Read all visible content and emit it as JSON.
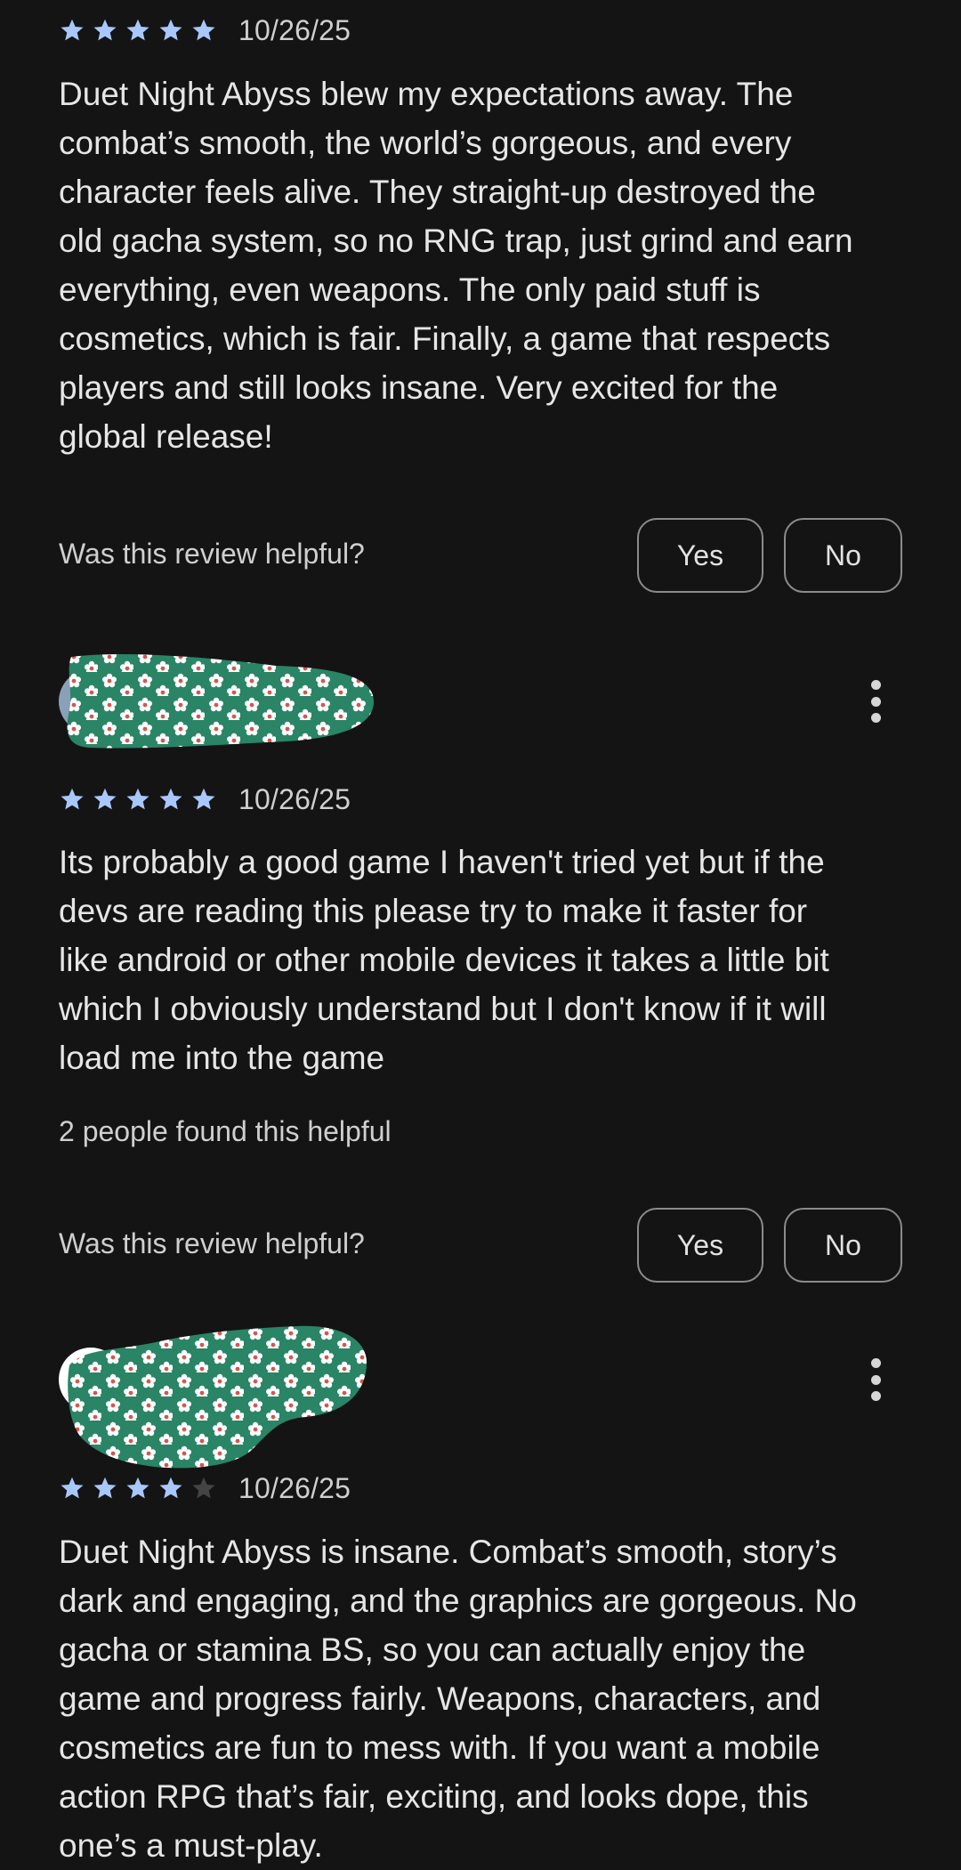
{
  "reviews": [
    {
      "rating": 5,
      "date": "10/26/25",
      "text": "Duet Night Abyss blew my expectations away. The\ncombat’s smooth, the world’s gorgeous, and every\ncharacter feels alive. They straight-up destroyed the\nold gacha system, so no RNG trap, just grind and earn\neverything, even weapons. The only paid stuff is\ncosmetics, which is fair. Finally, a game that respects\nplayers and still looks insane. Very excited for the\nglobal release!",
      "helpful_prompt": "Was this review helpful?",
      "yes_label": "Yes",
      "no_label": "No"
    },
    {
      "rating": 5,
      "date": "10/26/25",
      "text": "Its probably a good game I haven't tried yet but if the\ndevs are reading this please try to make it faster for\nlike android or other mobile devices it takes a little bit\nwhich I obviously understand but I don't know if it will\nload me into the game",
      "helpful_count": "2 people found this helpful",
      "helpful_prompt": "Was this review helpful?",
      "yes_label": "Yes",
      "no_label": "No"
    },
    {
      "rating": 4,
      "date": "10/26/25",
      "text": "Duet Night Abyss is insane. Combat’s smooth, story’s\ndark and engaging, and the graphics are gorgeous. No\ngacha or stamina BS, so you can actually enjoy the\ngame and progress fairly. Weapons, characters, and\ncosmetics are fun to mess with. If you want a mobile\naction RPG that’s fair, exciting, and looks dope, this\none’s a must-play."
    }
  ],
  "icons": {
    "star_filled": "star-icon",
    "star_empty": "star-outline-icon",
    "more": "more-vert-icon"
  },
  "colors": {
    "background": "#141414",
    "star_filled": "#a8c7fa",
    "star_empty": "#444444",
    "redaction_fill": "#2a8466",
    "redaction_flower": "#ffffff",
    "redaction_center": "#d9534f"
  }
}
